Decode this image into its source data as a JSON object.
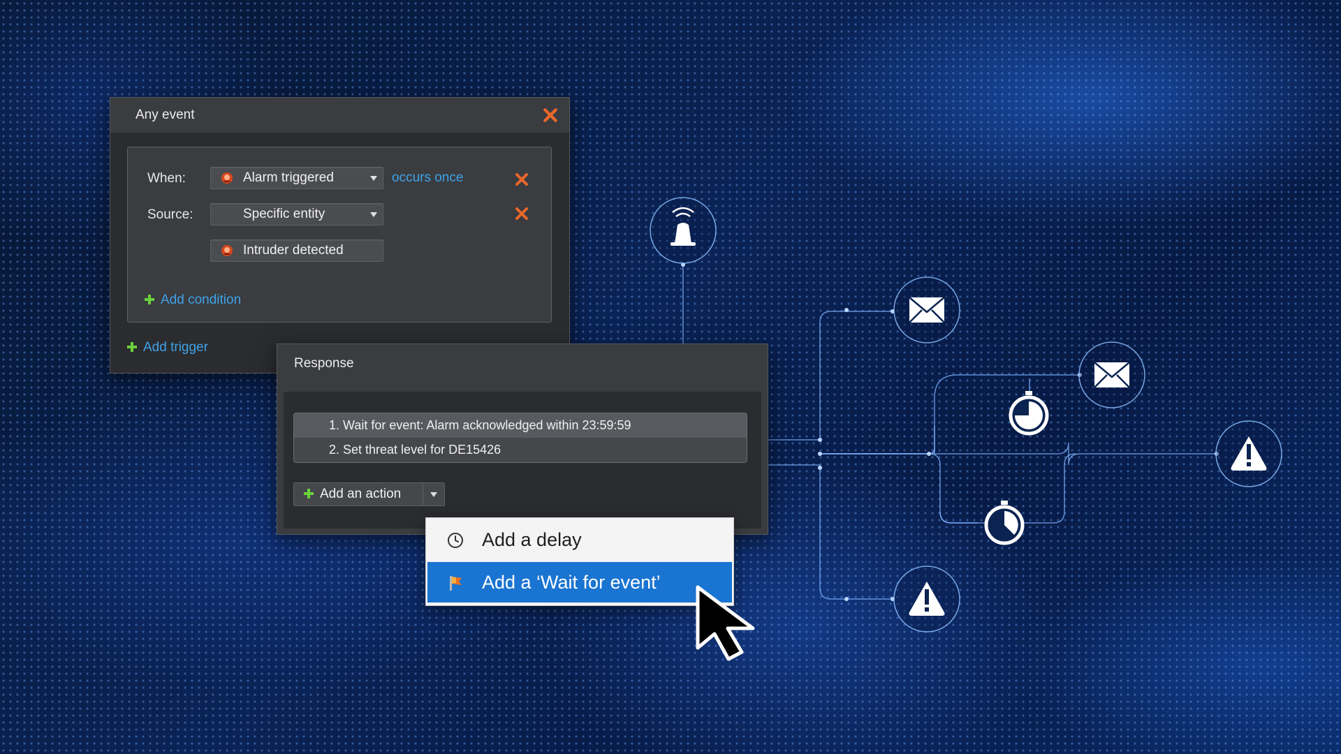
{
  "event_window": {
    "title": "Any event",
    "when_label": "When:",
    "when_value": "Alarm triggered",
    "occurs_link": "occurs once",
    "source_label": "Source:",
    "source_value": "Specific entity",
    "entity_value": "Intruder detected",
    "add_condition": "Add condition",
    "add_trigger": "Add trigger"
  },
  "response_window": {
    "title": "Response",
    "actions": [
      "1. Wait for event: Alarm acknowledged within 23:59:59",
      "2. Set threat level for DE15426"
    ],
    "add_action": "Add an action"
  },
  "action_menu": {
    "items": [
      {
        "label": "Add a delay",
        "icon": "clock-icon"
      },
      {
        "label": "Add a ‘Wait for event’",
        "icon": "flag-icon",
        "highlighted": true
      }
    ]
  },
  "flow_icons": [
    "alarm-beacon-icon",
    "mail-icon",
    "mail-icon",
    "stopwatch-icon",
    "stopwatch-icon",
    "warning-icon",
    "warning-icon"
  ],
  "colors": {
    "accent_link": "#3ea3e8",
    "menu_highlight": "#1a74d1",
    "plus_green": "#6ad23c",
    "close_orange": "#e8672a"
  }
}
